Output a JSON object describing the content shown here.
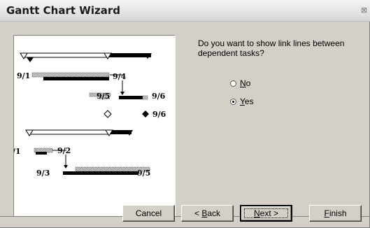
{
  "window": {
    "title": "Gantt Chart Wizard",
    "close_glyph": "⊠"
  },
  "question": "Do you want to show link lines between dependent tasks?",
  "options": [
    {
      "pre": "",
      "key": "N",
      "post": "o",
      "selected": false
    },
    {
      "pre": "",
      "key": "Y",
      "post": "es",
      "selected": true
    }
  ],
  "preview": {
    "labels": [
      "9/1",
      "9/4",
      "9/5",
      "9/6",
      "9/6",
      "/1",
      "9/2",
      "9/3",
      "9/5"
    ]
  },
  "buttons": {
    "cancel": {
      "pre": "Cancel",
      "key": "",
      "post": ""
    },
    "back": {
      "pre": "< ",
      "key": "B",
      "post": "ack"
    },
    "next": {
      "pre": "",
      "key": "N",
      "post": "ext >"
    },
    "finish": {
      "pre": "",
      "key": "F",
      "post": "inish"
    }
  },
  "colors": {
    "dialog_bg": "#d4d0c8",
    "title_bg": "#e4e4e4"
  }
}
